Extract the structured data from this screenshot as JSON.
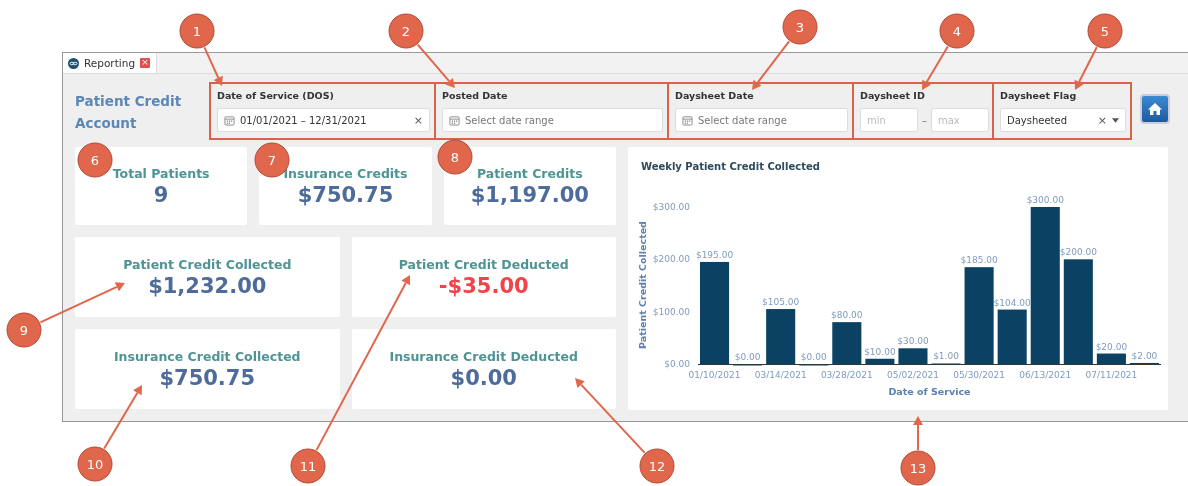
{
  "tab": {
    "label": "Reporting",
    "close": "×"
  },
  "page_title": "Patient Credit Account",
  "filters": [
    {
      "kind": "date",
      "label": "Date of Service (DOS)",
      "value": "01/01/2021 – 12/31/2021",
      "clear": "×"
    },
    {
      "kind": "date",
      "label": "Posted Date",
      "placeholder": "Select date range"
    },
    {
      "kind": "date",
      "label": "Daysheet Date",
      "placeholder": "Select date range"
    },
    {
      "kind": "range",
      "label": "Daysheet ID",
      "min_placeholder": "min",
      "separator": "–",
      "max_placeholder": "max"
    },
    {
      "kind": "select",
      "label": "Daysheet Flag",
      "value": "Daysheeted",
      "clear": "×"
    }
  ],
  "summary_row": [
    {
      "title": "Total Patients",
      "value": "9",
      "negative": false
    },
    {
      "title": "Insurance Credits",
      "value": "$750.75",
      "negative": false
    },
    {
      "title": "Patient Credits",
      "value": "$1,197.00",
      "negative": false
    }
  ],
  "detail_cards": [
    {
      "title": "Patient Credit Collected",
      "value": "$1,232.00",
      "negative": false
    },
    {
      "title": "Patient Credit Deducted",
      "value": "-$35.00",
      "negative": true
    },
    {
      "title": "Insurance Credit Collected",
      "value": "$750.75",
      "negative": false
    },
    {
      "title": "Insurance Credit Deducted",
      "value": "$0.00",
      "negative": false
    }
  ],
  "chart": {
    "chart_data": {
      "type": "bar",
      "title": "Weekly Patient Credit Collected",
      "xlabel": "Date of Service",
      "ylabel": "Patient Credit Collected",
      "categories": [
        "01/10/2021",
        null,
        "03/14/2021",
        null,
        "03/28/2021",
        null,
        "05/02/2021",
        null,
        "05/30/2021",
        null,
        "06/13/2021",
        null,
        "07/11/2021",
        null
      ],
      "values": [
        195,
        0,
        105,
        0,
        80,
        10,
        30,
        1,
        185,
        104,
        300,
        200,
        20,
        2
      ],
      "value_labels": [
        "$195.00",
        "$0.00",
        "$105.00",
        "$0.00",
        "$80.00",
        "$10.00",
        "$30.00",
        "$1.00",
        "$185.00",
        "$104.00",
        "$300.00",
        "$200.00",
        "$20.00",
        "$2.00"
      ],
      "ylim": [
        0,
        300
      ],
      "yticks": [
        {
          "value": 0,
          "label": "$0.00"
        },
        {
          "value": 100,
          "label": "$100.00"
        },
        {
          "value": 200,
          "label": "$200.00"
        },
        {
          "value": 300,
          "label": "$300.00"
        }
      ]
    }
  },
  "callouts": [
    "1",
    "2",
    "3",
    "4",
    "5",
    "6",
    "7",
    "8",
    "9",
    "10",
    "11",
    "12",
    "13"
  ]
}
